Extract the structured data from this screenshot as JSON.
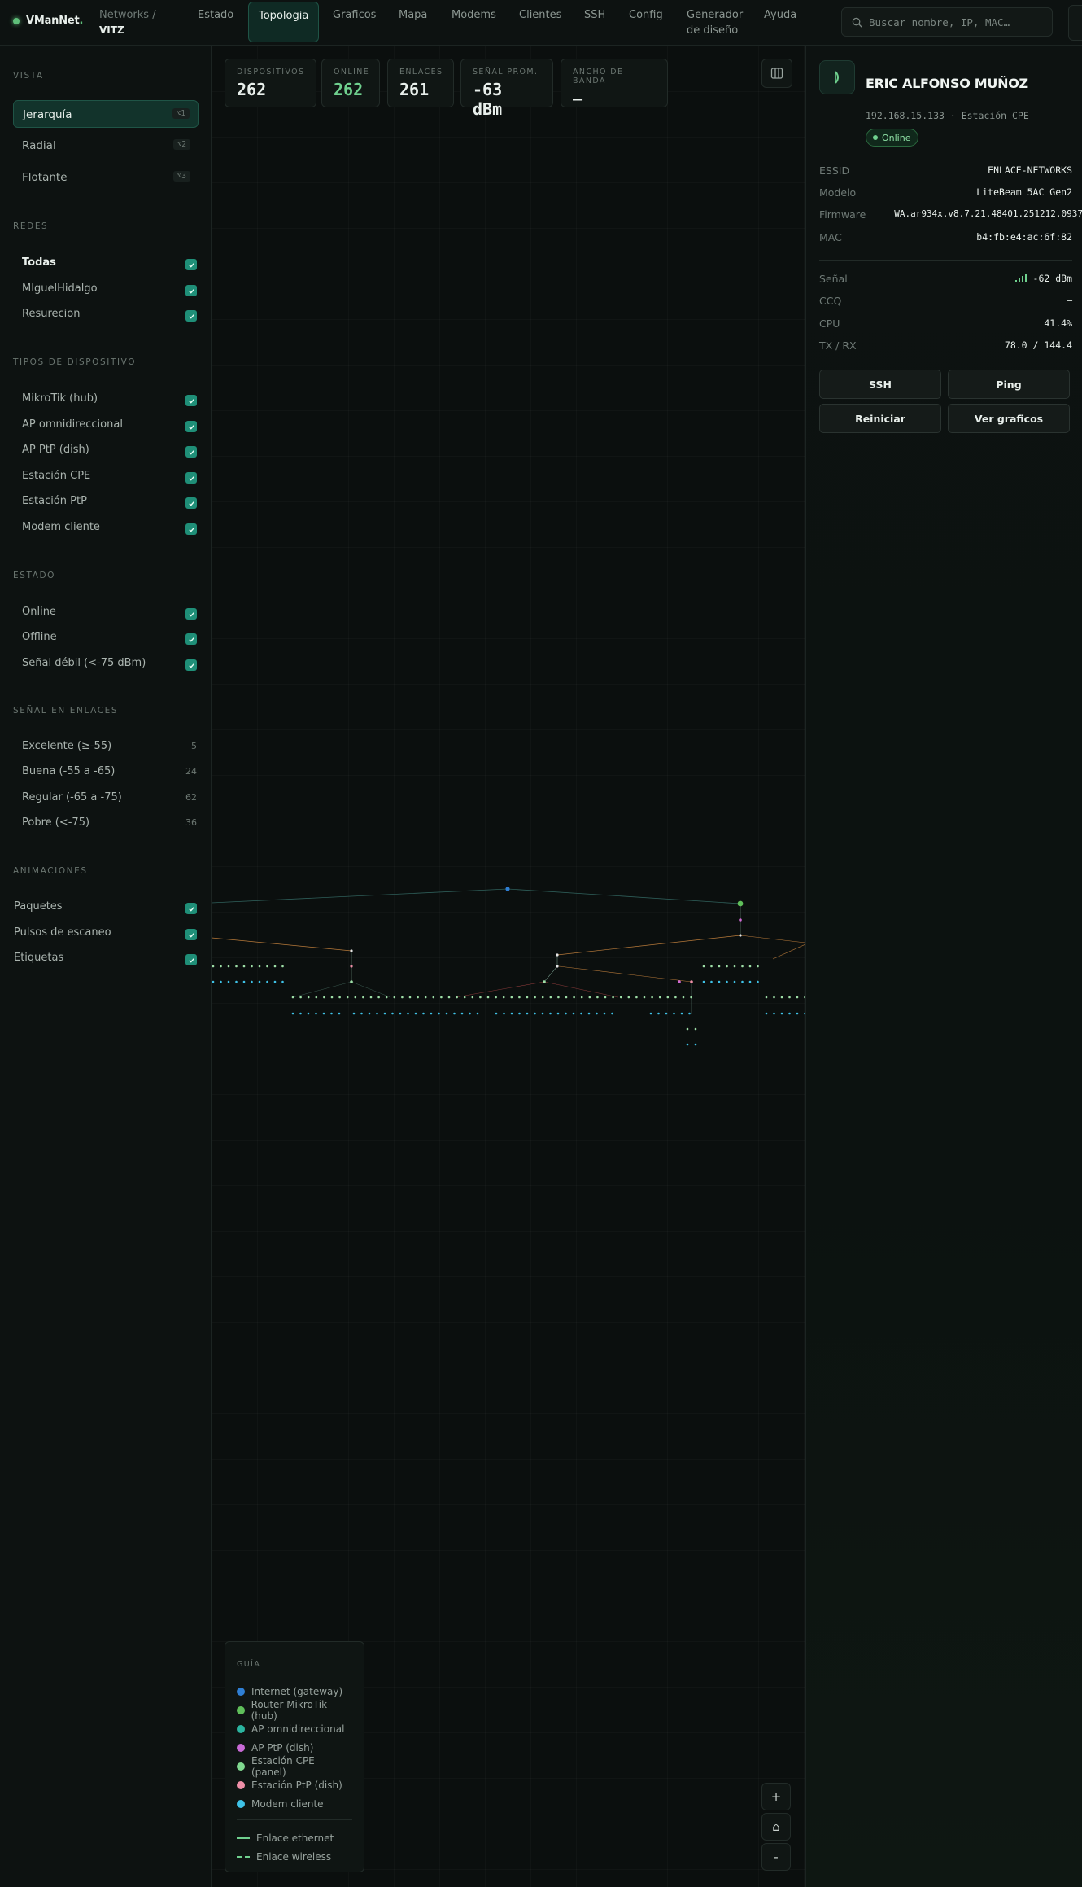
{
  "brand": {
    "name": "VManNet",
    "dot": "."
  },
  "breadcrumb": {
    "parent": "Networks",
    "separator": "/",
    "current": "VITZ"
  },
  "nav": {
    "items": [
      {
        "label": "Estado"
      },
      {
        "label": "Topologia"
      },
      {
        "label": "Graficos"
      },
      {
        "label": "Mapa"
      },
      {
        "label": "Modems"
      },
      {
        "label": "Clientes"
      },
      {
        "label": "SSH"
      },
      {
        "label": "Config"
      },
      {
        "label": "Generador",
        "label2": "de diseño"
      },
      {
        "label": "Ayuda"
      }
    ],
    "active": "Topologia"
  },
  "search": {
    "placeholder": "Buscar nombre, IP, MAC…",
    "icon": "search-icon"
  },
  "sidebar": {
    "vista": {
      "title": "VISTA",
      "items": [
        {
          "label": "Jerarquía",
          "kbd": "⌥1"
        },
        {
          "label": "Radial",
          "kbd": "⌥2"
        },
        {
          "label": "Flotante",
          "kbd": "⌥3"
        }
      ]
    },
    "redes": {
      "title": "REDES",
      "items": [
        {
          "label": "Todas",
          "checked": true
        },
        {
          "label": "MIguelHidalgo",
          "checked": true
        },
        {
          "label": "Resurecion",
          "checked": true
        }
      ]
    },
    "tipos": {
      "title": "TIPOS DE DISPOSITIVO",
      "items": [
        {
          "label": "MikroTik (hub)",
          "checked": true
        },
        {
          "label": "AP omnidireccional",
          "checked": true
        },
        {
          "label": "AP PtP (dish)",
          "checked": true
        },
        {
          "label": "Estación CPE",
          "checked": true
        },
        {
          "label": "Estación PtP",
          "checked": true
        },
        {
          "label": "Modem cliente",
          "checked": true
        }
      ]
    },
    "estado": {
      "title": "ESTADO",
      "items": [
        {
          "label": "Online",
          "checked": true
        },
        {
          "label": "Offline",
          "checked": true
        },
        {
          "label": "Señal débil (<-75 dBm)",
          "checked": true
        }
      ]
    },
    "senal": {
      "title": "SEÑAL EN ENLACES",
      "items": [
        {
          "label": "Excelente (≥-55)",
          "count": "5"
        },
        {
          "label": "Buena (-55 a -65)",
          "count": "24"
        },
        {
          "label": "Regular (-65 a -75)",
          "count": "62"
        },
        {
          "label": "Pobre (<-75)",
          "count": "36"
        }
      ]
    },
    "animaciones": {
      "title": "ANIMACIONES",
      "items": [
        {
          "label": "Paquetes",
          "checked": true
        },
        {
          "label": "Pulsos de escaneo",
          "checked": true
        },
        {
          "label": "Etiquetas",
          "checked": true
        }
      ]
    }
  },
  "stats": [
    {
      "label": "DISPOSITIVOS",
      "value": "262"
    },
    {
      "label": "ONLINE",
      "value": "262"
    },
    {
      "label": "ENLACES",
      "value": "261"
    },
    {
      "label": "SEÑAL PROM.",
      "value": "-63 dBm"
    },
    {
      "label": "ANCHO DE BANDA",
      "value": "—"
    }
  ],
  "legend": {
    "title": "GUÍA",
    "items": [
      {
        "label": "Internet (gateway)",
        "color": "#2f7fd4"
      },
      {
        "label": "Router MikroTik (hub)",
        "color": "#5fbf5a"
      },
      {
        "label": "AP omnidireccional",
        "color": "#2bb5a0"
      },
      {
        "label": "AP PtP (dish)",
        "color": "#c86ad6"
      },
      {
        "label": "Estación CPE (panel)",
        "color": "#7fd88f"
      },
      {
        "label": "Estación PtP (dish)",
        "color": "#ef8fa8"
      },
      {
        "label": "Modem cliente",
        "color": "#3fc3e8"
      }
    ],
    "links": [
      {
        "label": "Enlace ethernet",
        "style": "solid"
      },
      {
        "label": "Enlace wireless",
        "style": "dashed"
      }
    ]
  },
  "zoom": {
    "in": "+",
    "home": "⌂",
    "out": "-"
  },
  "device": {
    "name": "ERIC ALFONSO MUÑOZ",
    "subtitle": "192.168.15.133 · Estación CPE",
    "status": "Online",
    "icon": "cpe-panel-icon",
    "info": [
      {
        "key": "ESSID",
        "value": "ENLACE-NETWORKS"
      },
      {
        "key": "Modelo",
        "value": "LiteBeam 5AC Gen2"
      },
      {
        "key": "Firmware",
        "value": "WA.ar934x.v8.7.21.48401.251212.0937"
      },
      {
        "key": "MAC",
        "value": "b4:fb:e4:ac:6f:82"
      }
    ],
    "metrics": [
      {
        "key": "Señal",
        "value": "-62 dBm"
      },
      {
        "key": "CCQ",
        "value": "—"
      },
      {
        "key": "CPU",
        "value": "41.4%"
      },
      {
        "key": "TX / RX",
        "value": "78.0 / 144.4"
      }
    ],
    "actions": [
      {
        "label": "SSH"
      },
      {
        "label": "Ping"
      },
      {
        "label": "Reiniciar"
      },
      {
        "label": "Ver graficos"
      }
    ]
  },
  "colors": {
    "accent": "#1f8f78",
    "online": "#6fd08e",
    "background": "#0b0f0e"
  }
}
